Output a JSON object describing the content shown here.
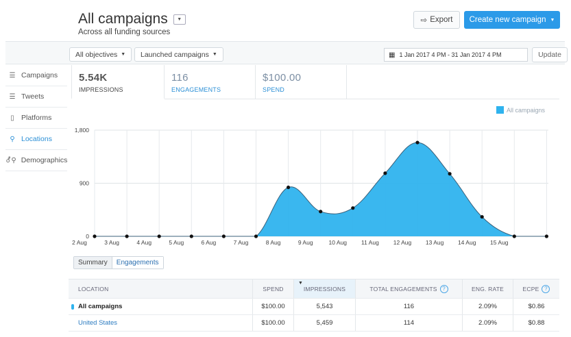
{
  "header": {
    "title": "All campaigns",
    "subtitle": "Across all funding sources",
    "export_label": "Export",
    "create_label": "Create new campaign"
  },
  "filters": {
    "objectives_label": "All objectives",
    "status_label": "Launched campaigns",
    "date_range": "1 Jan 2017 4 PM  - 31 Jan 2017 4 PM",
    "update_label": "Update"
  },
  "sidebar": {
    "items": [
      {
        "label": "Campaigns",
        "icon": "list-icon"
      },
      {
        "label": "Tweets",
        "icon": "list-icon"
      },
      {
        "label": "Platforms",
        "icon": "device-icon"
      },
      {
        "label": "Locations",
        "icon": "location-pin-icon"
      },
      {
        "label": "Demographics",
        "icon": "demographics-icon"
      }
    ]
  },
  "metrics": [
    {
      "value": "5.54K",
      "label": "IMPRESSIONS"
    },
    {
      "value": "116",
      "label": "ENGAGEMENTS"
    },
    {
      "value": "$100.00",
      "label": "SPEND"
    }
  ],
  "legend": {
    "label": "All campaigns",
    "color": "#2fb3ee"
  },
  "toggles": {
    "summary": "Summary",
    "engagements": "Engagements"
  },
  "chart_data": {
    "type": "area",
    "x": [
      "2 Aug",
      "3 Aug",
      "4 Aug",
      "5 Aug",
      "6 Aug",
      "7 Aug",
      "8 Aug",
      "9 Aug",
      "10 Aug",
      "11 Aug",
      "12 Aug",
      "13 Aug",
      "14 Aug",
      "15 Aug"
    ],
    "series": [
      {
        "name": "All campaigns",
        "values": [
          0,
          0,
          0,
          0,
          0,
          0,
          830,
          420,
          480,
          1070,
          1590,
          1060,
          330,
          0,
          0
        ]
      }
    ],
    "x_extra_point": true,
    "ylim": [
      0,
      1800
    ],
    "yticks": [
      "1,800",
      "900",
      "0"
    ],
    "grid": true,
    "color": "#2fb3ee"
  },
  "table": {
    "headers": {
      "location": "LOCATION",
      "spend": "SPEND",
      "impressions": "IMPRESSIONS",
      "total_engagements": "TOTAL ENGAGEMENTS",
      "eng_rate": "ENG. RATE",
      "ecpe": "ECPE"
    },
    "rows": [
      {
        "location": "All campaigns",
        "spend": "$100.00",
        "impressions": "5,543",
        "engagements": "116",
        "eng_rate": "2.09%",
        "ecpe": "$0.86"
      },
      {
        "location": "United States",
        "spend": "$100.00",
        "impressions": "5,459",
        "engagements": "114",
        "eng_rate": "2.09%",
        "ecpe": "$0.88"
      }
    ]
  }
}
